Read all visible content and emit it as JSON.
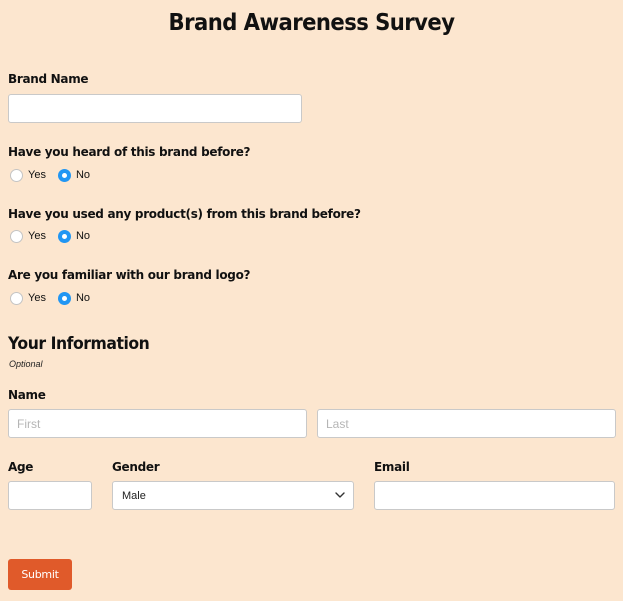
{
  "form": {
    "title": "Brand Awareness Survey",
    "brand_name": {
      "label": "Brand Name",
      "value": ""
    },
    "questions": [
      {
        "label": "Have you heard of this brand before?",
        "options": [
          "Yes",
          "No"
        ],
        "selected": "No"
      },
      {
        "label": "Have you used any product(s) from this brand before?",
        "options": [
          "Yes",
          "No"
        ],
        "selected": "No"
      },
      {
        "label": "Are you familiar with our brand logo?",
        "options": [
          "Yes",
          "No"
        ],
        "selected": "No"
      }
    ],
    "your_information": {
      "title": "Your Information",
      "subtitle": "Optional"
    },
    "name": {
      "label": "Name",
      "first_placeholder": "First",
      "last_placeholder": "Last"
    },
    "age": {
      "label": "Age",
      "value": ""
    },
    "gender": {
      "label": "Gender",
      "selected": "Male"
    },
    "email": {
      "label": "Email",
      "value": ""
    },
    "submit_label": "Submit"
  },
  "colors": {
    "background": "#fce6cf",
    "radio_checked": "#2196f3",
    "submit": "#e05a2a"
  },
  "icons": {
    "select": "chevron-down-icon"
  }
}
